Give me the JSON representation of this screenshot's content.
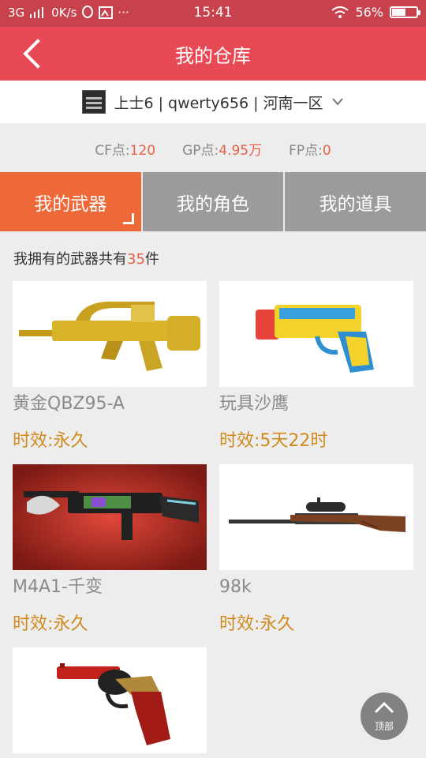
{
  "status_bar": {
    "network": "3G",
    "speed": "0K/s",
    "time": "15:41",
    "battery": "56%",
    "battery_level": 0.56
  },
  "header": {
    "title": "我的仓库",
    "back_icon": "chevron-left-icon"
  },
  "account": {
    "label": "上士6 | qwerty656 | 河南一区",
    "dropdown_icon": "chevron-down-icon"
  },
  "points": [
    {
      "label": "CF点:",
      "value": "120"
    },
    {
      "label": "GP点:",
      "value": "4.95万"
    },
    {
      "label": "FP点:",
      "value": "0"
    }
  ],
  "tabs": [
    {
      "label": "我的武器",
      "active": true
    },
    {
      "label": "我的角色",
      "active": false
    },
    {
      "label": "我的道具",
      "active": false
    }
  ],
  "weapons_count": {
    "prefix": "我拥有的武器共有",
    "count": "35",
    "suffix": "件"
  },
  "weapons": [
    {
      "name": "黄金QBZ95-A",
      "duration": "时效:永久"
    },
    {
      "name": "玩具沙鹰",
      "duration": "时效:5天22时"
    },
    {
      "name": "M4A1-千变",
      "duration": "时效:永久"
    },
    {
      "name": "98k",
      "duration": "时效:永久"
    },
    {
      "name": "",
      "duration": ""
    }
  ],
  "top_button": {
    "label": "顶部"
  },
  "colors": {
    "header": "#e74a54",
    "active_tab": "#ef6837",
    "accent": "#e8604a",
    "duration": "#d08a1c"
  }
}
